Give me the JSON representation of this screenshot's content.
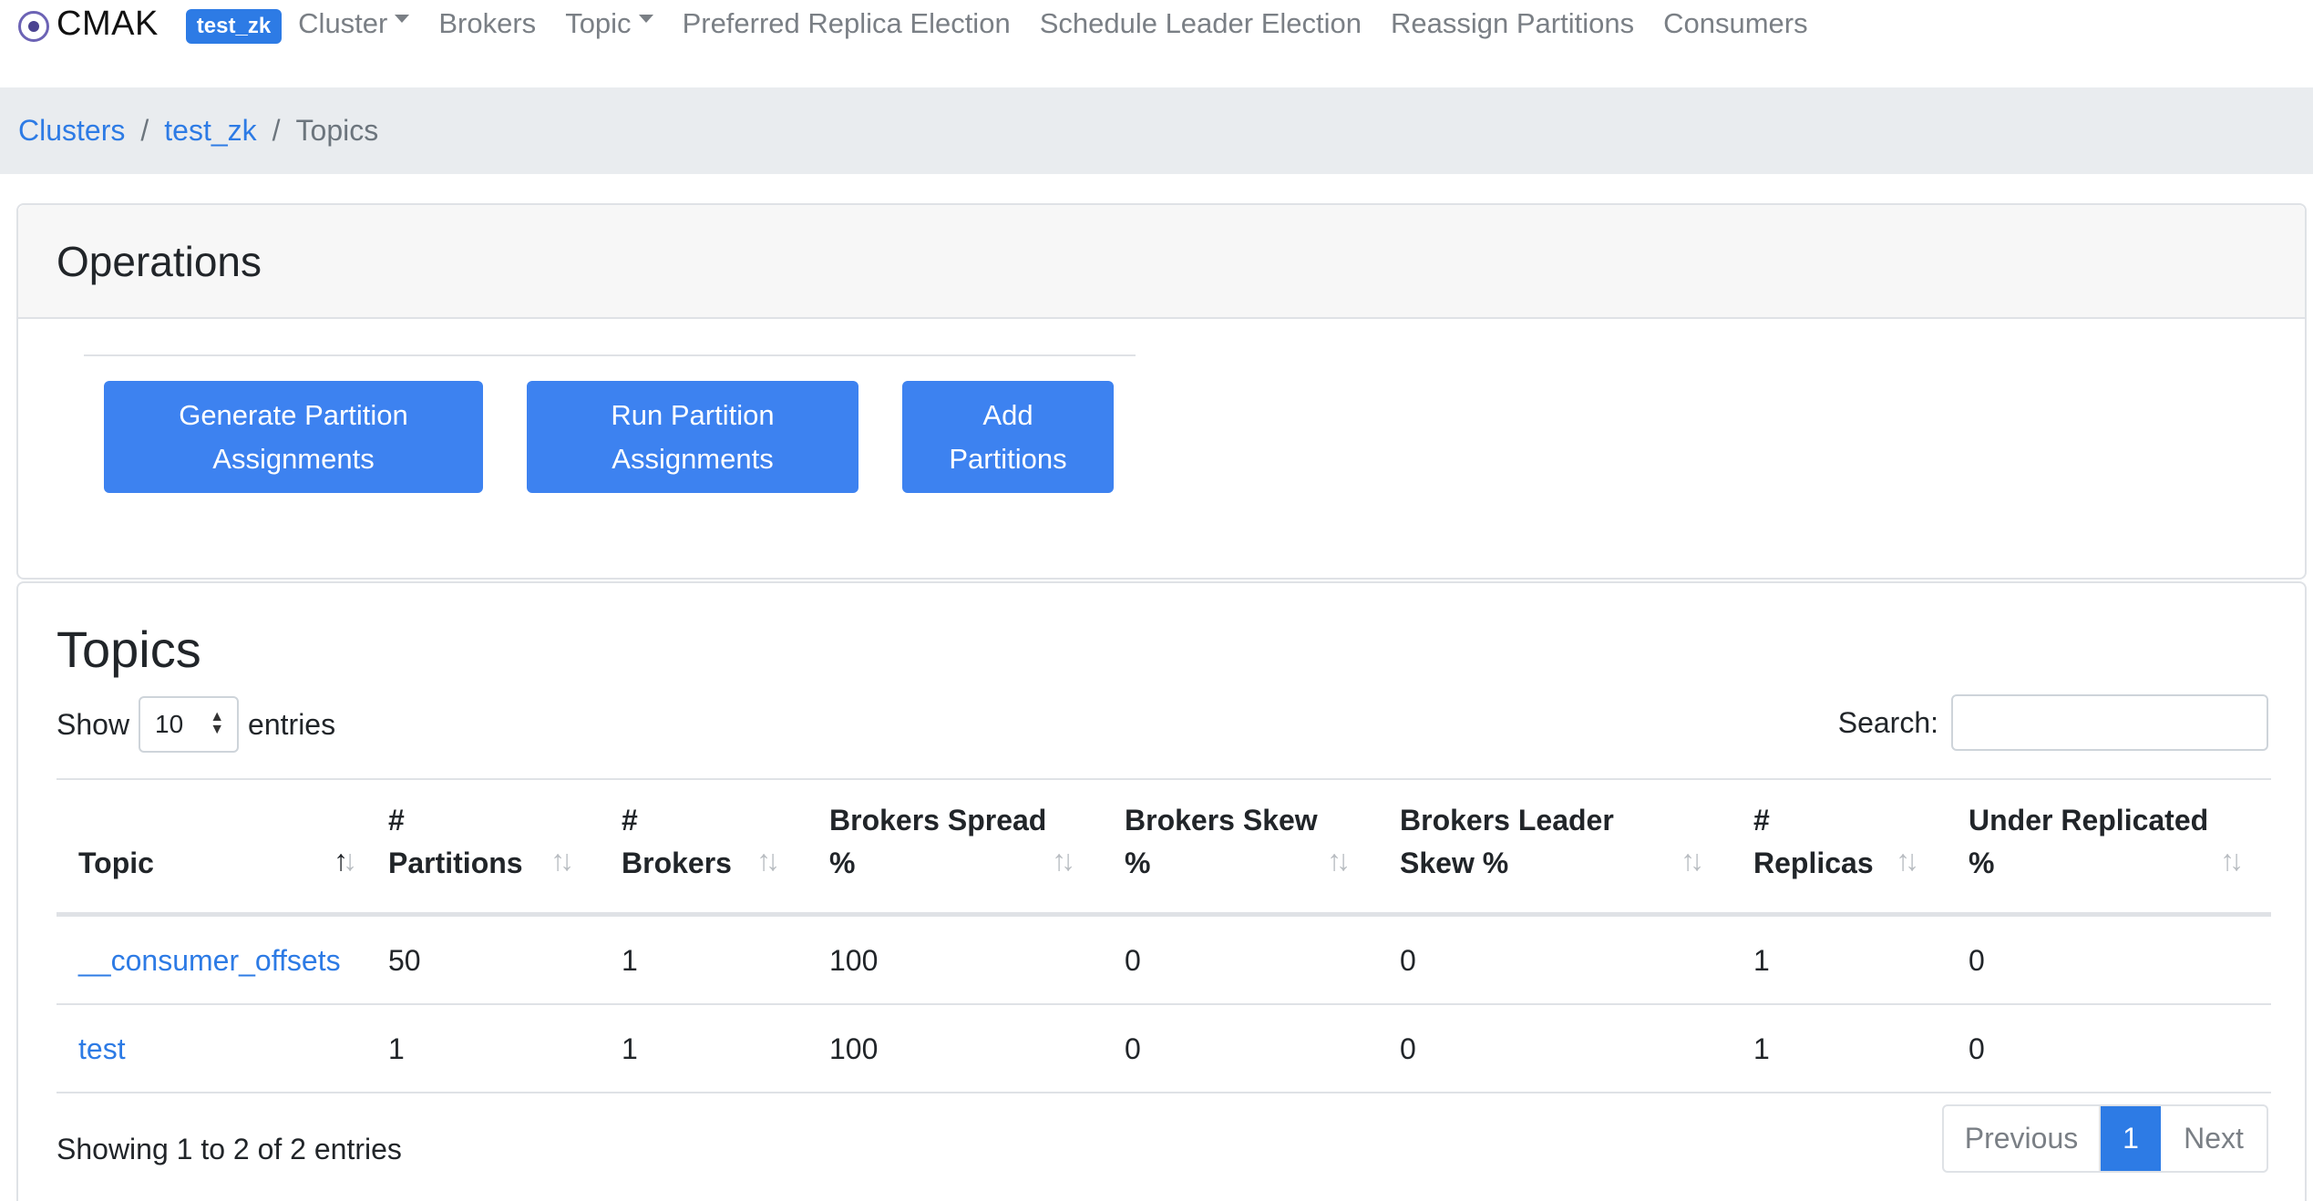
{
  "navbar": {
    "brand": "CMAK",
    "cluster_badge": "test_zk",
    "items": [
      {
        "label": "Cluster",
        "dropdown": true
      },
      {
        "label": "Brokers",
        "dropdown": false
      },
      {
        "label": "Topic",
        "dropdown": true
      },
      {
        "label": "Preferred Replica Election",
        "dropdown": false
      },
      {
        "label": "Schedule Leader Election",
        "dropdown": false
      },
      {
        "label": "Reassign Partitions",
        "dropdown": false
      },
      {
        "label": "Consumers",
        "dropdown": false
      }
    ]
  },
  "breadcrumb": {
    "clusters": "Clusters",
    "cluster": "test_zk",
    "current": "Topics",
    "separator": "/"
  },
  "operations": {
    "title": "Operations",
    "generate": {
      "line1": "Generate Partition",
      "line2": "Assignments"
    },
    "run": {
      "line1": "Run Partition",
      "line2": "Assignments"
    },
    "add": {
      "line1": "Add",
      "line2": "Partitions"
    }
  },
  "topics": {
    "title": "Topics",
    "show_label": "Show",
    "entries_value": "10",
    "entries_label": "entries",
    "search_label": "Search:",
    "search_value": "",
    "columns": [
      {
        "line1": "Topic",
        "line2": ""
      },
      {
        "line1": "#",
        "line2": "Partitions"
      },
      {
        "line1": "#",
        "line2": "Brokers"
      },
      {
        "line1": "Brokers Spread",
        "line2": "%"
      },
      {
        "line1": "Brokers Skew",
        "line2": "%"
      },
      {
        "line1": "Brokers Leader",
        "line2": "Skew %"
      },
      {
        "line1": "#",
        "line2": "Replicas"
      },
      {
        "line1": "Under Replicated",
        "line2": "%"
      }
    ],
    "rows": [
      [
        "__consumer_offsets",
        "50",
        "1",
        "100",
        "0",
        "0",
        "1",
        "0"
      ],
      [
        "test",
        "1",
        "1",
        "100",
        "0",
        "0",
        "1",
        "0"
      ]
    ],
    "info": "Showing 1 to 2 of 2 entries",
    "pagination": {
      "previous": "Previous",
      "page": "1",
      "next": "Next"
    }
  },
  "colors": {
    "primary": "#3d82f0",
    "link": "#2d7be5",
    "breadcrumb_bg": "#e9ecef"
  }
}
